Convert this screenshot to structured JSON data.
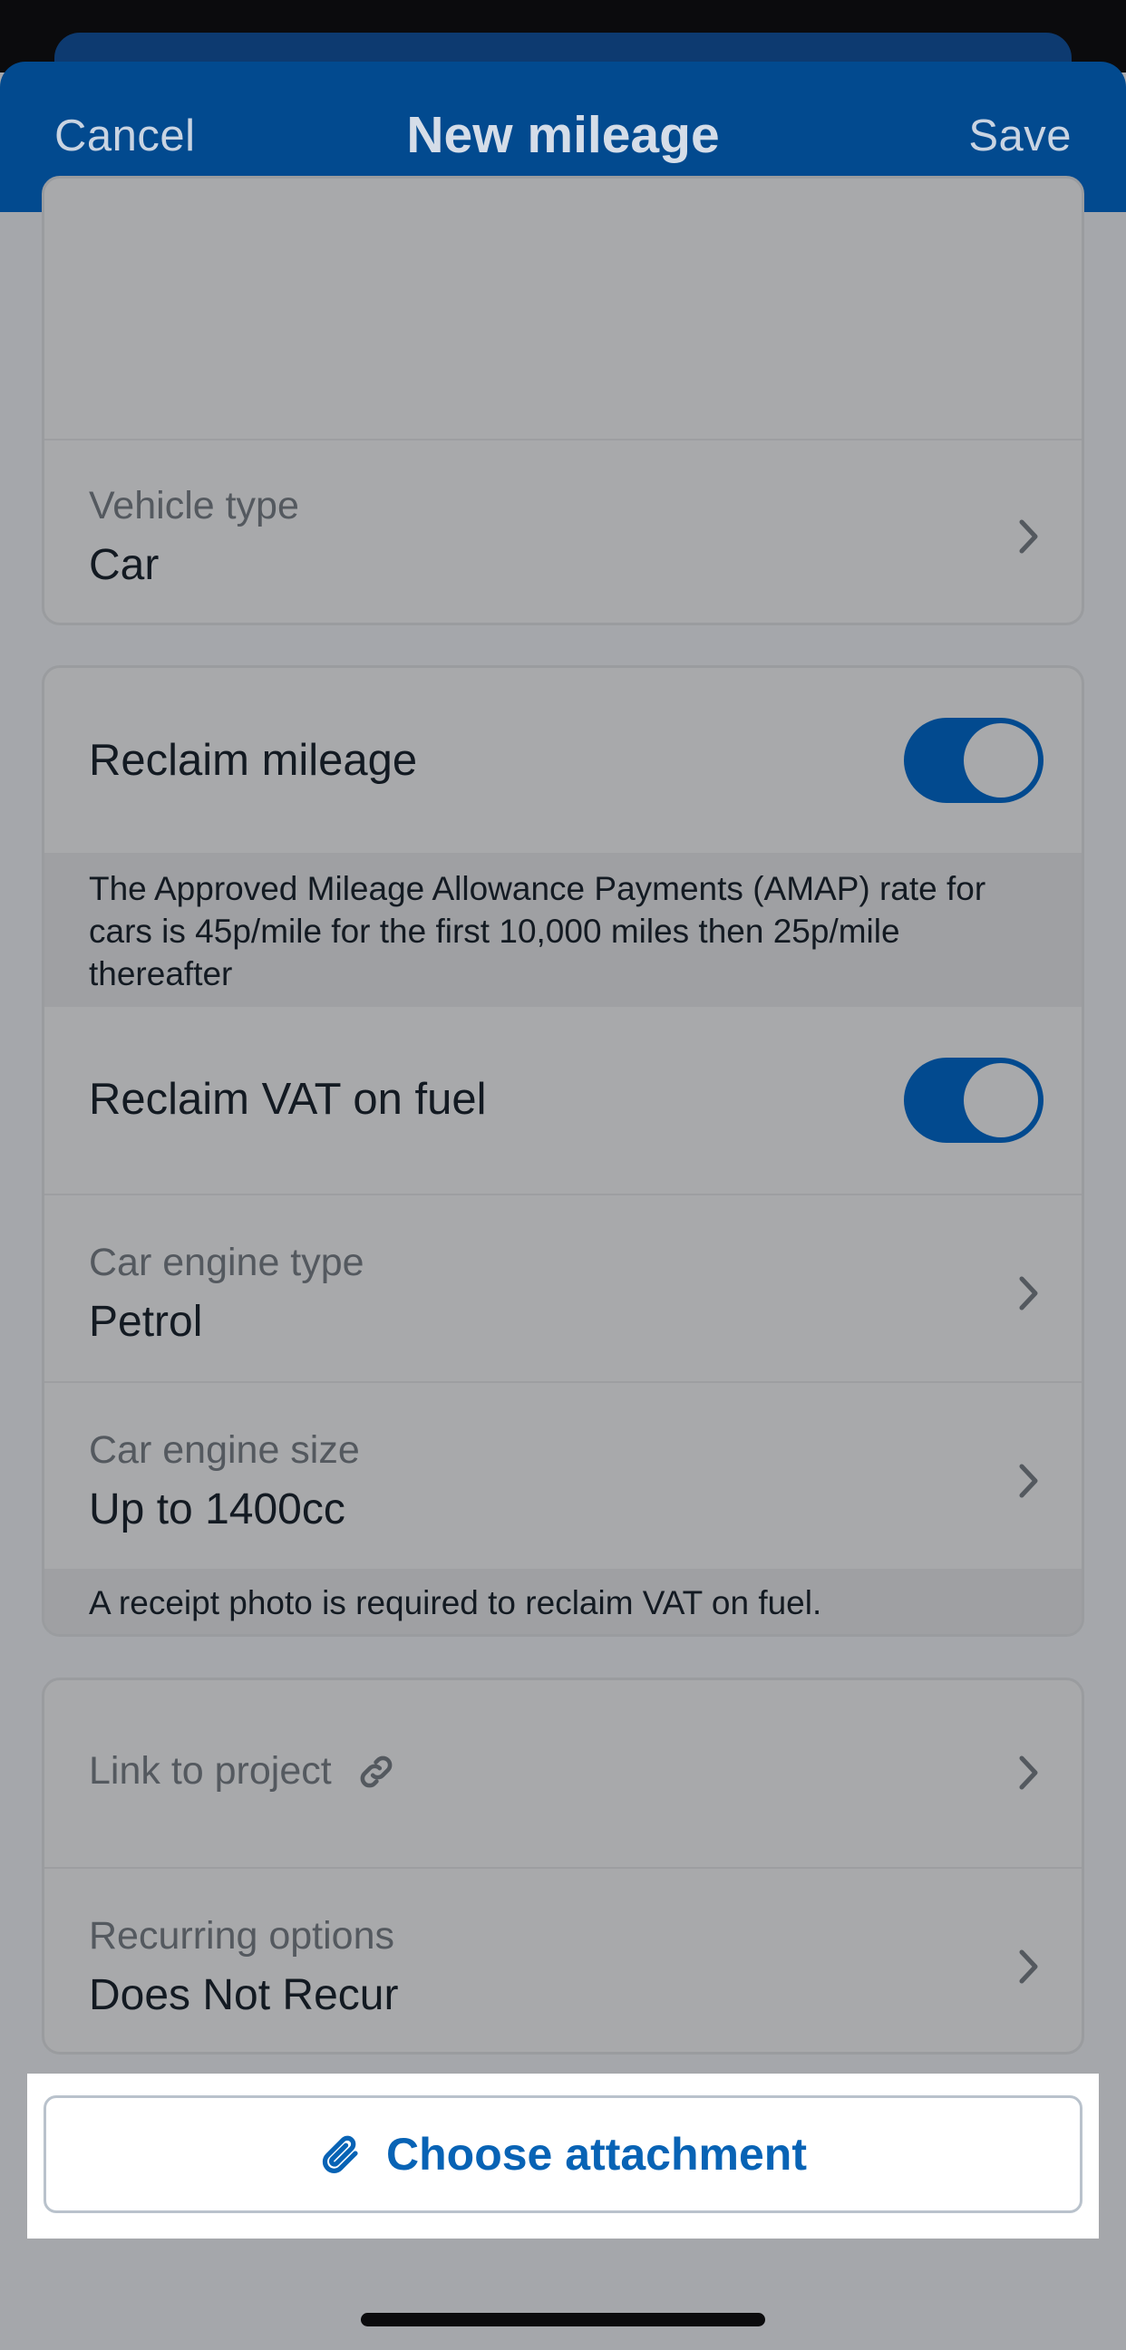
{
  "nav": {
    "cancel_label": "Cancel",
    "title": "New mileage",
    "save_label": "Save"
  },
  "vehicle": {
    "label": "Vehicle type",
    "value": "Car"
  },
  "reclaim_mileage": {
    "label": "Reclaim mileage",
    "enabled": true,
    "note": "The Approved Mileage Allowance Payments (AMAP) rate for cars is 45p/mile for the first 10,000 miles then 25p/mile thereafter"
  },
  "reclaim_vat": {
    "label": "Reclaim VAT on fuel",
    "enabled": true
  },
  "engine_type": {
    "label": "Car engine type",
    "value": "Petrol"
  },
  "engine_size": {
    "label": "Car engine size",
    "value": "Up to 1400cc"
  },
  "vat_note": "A receipt photo is required to reclaim VAT on fuel.",
  "project": {
    "label": "Link to project",
    "icon": "link-icon"
  },
  "recurring": {
    "label": "Recurring options",
    "value": "Does Not Recur"
  },
  "attachment": {
    "label": "Choose attachment",
    "icon": "paperclip-icon"
  },
  "colors": {
    "brand": "#024a8f",
    "accent_link": "#0863b5"
  }
}
